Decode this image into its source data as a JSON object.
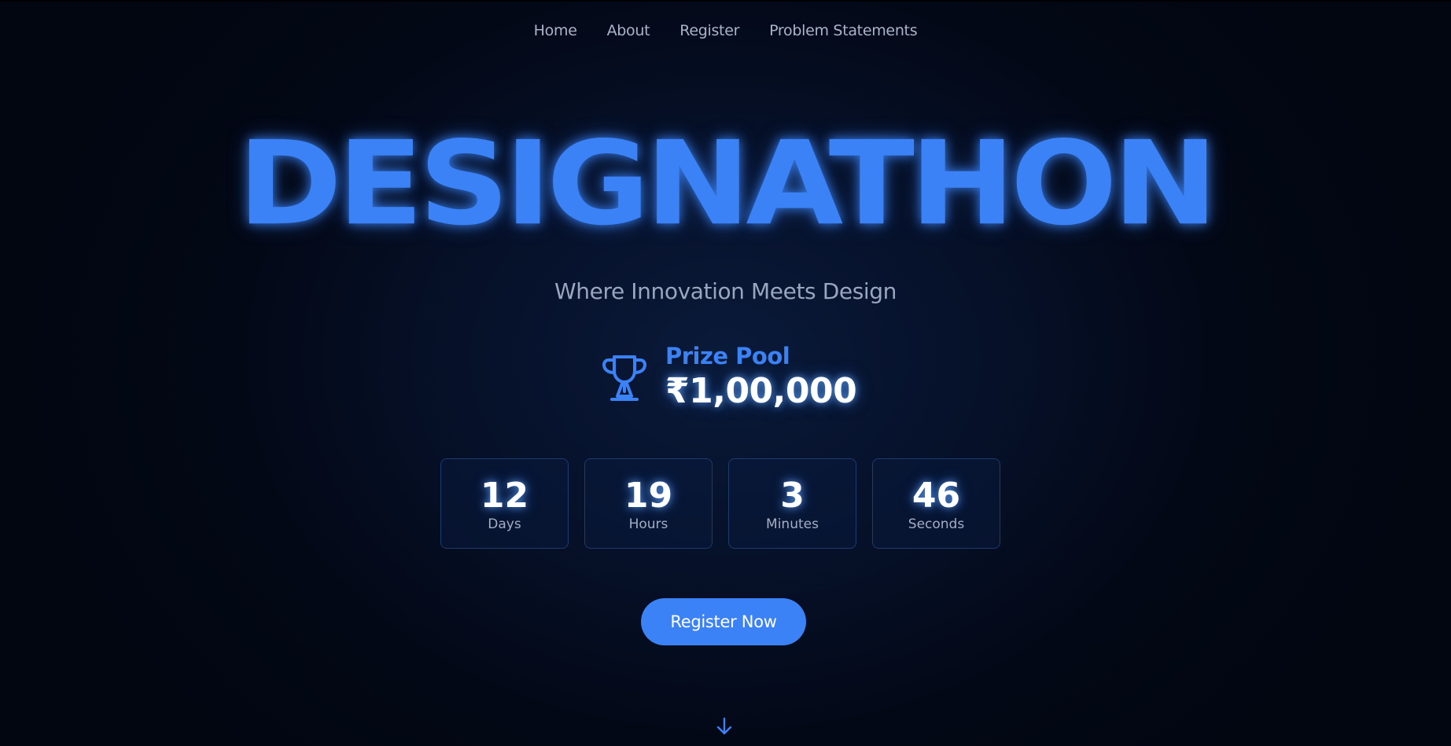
{
  "nav": {
    "items": [
      {
        "label": "Home"
      },
      {
        "label": "About"
      },
      {
        "label": "Register"
      },
      {
        "label": "Problem Statements"
      }
    ]
  },
  "hero": {
    "title": "DESIGNATHON",
    "subtitle": "Where Innovation Meets Design"
  },
  "prize": {
    "icon": "trophy-icon",
    "label": "Prize Pool",
    "amount": "₹1,00,000"
  },
  "countdown": [
    {
      "value": "12",
      "label": "Days"
    },
    {
      "value": "19",
      "label": "Hours"
    },
    {
      "value": "3",
      "label": "Minutes"
    },
    {
      "value": "46",
      "label": "Seconds"
    }
  ],
  "cta": {
    "register_label": "Register Now"
  },
  "scroll_icon": "arrow-down-icon",
  "colors": {
    "accent": "#3b82f6",
    "background": "#030816",
    "muted_text": "#9aa6bd"
  }
}
